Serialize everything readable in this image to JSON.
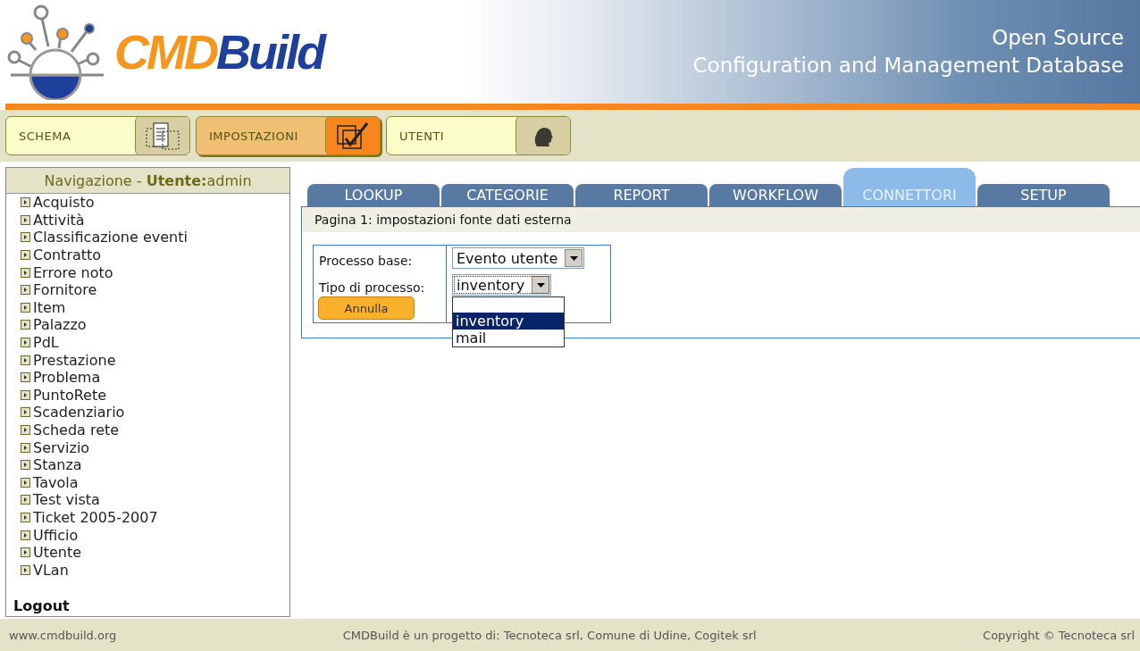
{
  "logo": {
    "part_1": "CMD",
    "part_2": "Build"
  },
  "tagline": [
    "Open Source",
    "Configuration and Management Database"
  ],
  "modules": [
    {
      "label": "SCHEMA",
      "kind": "schema",
      "selected": false
    },
    {
      "label": "IMPOSTAZIONI",
      "kind": "settings",
      "selected": true
    },
    {
      "label": "UTENTI",
      "kind": "users",
      "selected": false
    }
  ],
  "sidebar": {
    "title": "Navigazione - **Utente:**admin",
    "items": [
      "Acquisto",
      "Attività",
      "Classificazione eventi",
      "Contratto",
      "Errore noto",
      "Fornitore",
      "Item",
      "Palazzo",
      "PdL",
      "Prestazione",
      "Problema",
      "PuntoRete",
      "Scadenziario",
      "Scheda rete",
      "Servizio",
      "Stanza",
      "Tavola",
      "Test vista",
      "Ticket 2005-2007",
      "Ufficio",
      "Utente",
      "VLan"
    ],
    "logout": "Logout"
  },
  "tabs": [
    {
      "label": "LOOKUP",
      "selected": false
    },
    {
      "label": "CATEGORIE",
      "selected": false
    },
    {
      "label": "REPORT",
      "selected": false
    },
    {
      "label": "WORKFLOW",
      "selected": false
    },
    {
      "label": "CONNETTORI",
      "selected": true
    },
    {
      "label": "SETUP",
      "selected": false
    }
  ],
  "page_header": "Pagina 1: impostazioni fonte dati esterna",
  "form": {
    "fields": [
      {
        "label": "Processo base:",
        "value": "Evento utente",
        "expanded": false
      },
      {
        "label": "Tipo di processo:",
        "value": "inventory",
        "expanded": true,
        "options": [
          {
            "label": "inventory",
            "selected": true
          },
          {
            "label": "mail",
            "selected": false
          }
        ]
      }
    ],
    "cancel_button": "Annulla"
  },
  "footer": {
    "left": "www.cmdbuild.org",
    "center": "CMDBuild è un progetto di: Tecnoteca srl, Comune di Udine, Cogitek srl",
    "right": "Copyright © Tecnoteca srl"
  }
}
